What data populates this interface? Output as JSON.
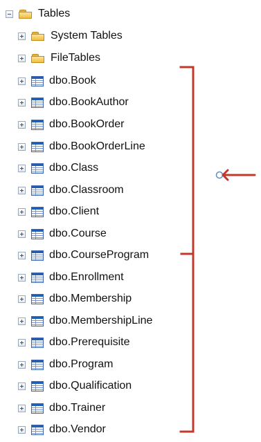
{
  "tree": {
    "root": {
      "label": "Tables"
    },
    "folders": [
      {
        "label": "System Tables"
      },
      {
        "label": "FileTables"
      }
    ],
    "tables": [
      {
        "label": "dbo.Book"
      },
      {
        "label": "dbo.BookAuthor"
      },
      {
        "label": "dbo.BookOrder"
      },
      {
        "label": "dbo.BookOrderLine"
      },
      {
        "label": "dbo.Class"
      },
      {
        "label": "dbo.Classroom"
      },
      {
        "label": "dbo.Client"
      },
      {
        "label": "dbo.Course"
      },
      {
        "label": "dbo.CourseProgram"
      },
      {
        "label": "dbo.Enrollment"
      },
      {
        "label": "dbo.Membership"
      },
      {
        "label": "dbo.MembershipLine"
      },
      {
        "label": "dbo.Prerequisite"
      },
      {
        "label": "dbo.Program"
      },
      {
        "label": "dbo.Qualification"
      },
      {
        "label": "dbo.Trainer"
      },
      {
        "label": "dbo.Vendor"
      }
    ]
  },
  "annotation": {
    "color": "#c0392b"
  },
  "icons": {
    "expander_expanded": "minus-expander",
    "expander_collapsed": "plus-expander",
    "folder": "folder-icon",
    "table": "table-icon",
    "pointer": "circle-marker",
    "arrow": "left-arrow"
  }
}
